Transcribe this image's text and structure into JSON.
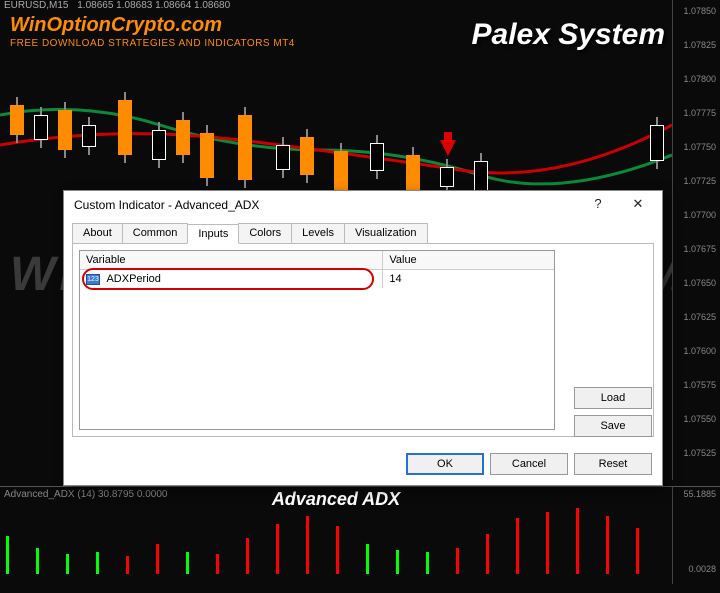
{
  "header": {
    "symbol": "EURUSD,M15",
    "ohlc": "1.08665 1.08683 1.08664 1.08680"
  },
  "branding": {
    "site": "WinOptionCrypto.com",
    "tagline": "FREE DOWNLOAD STRATEGIES AND INDICATORS MT4",
    "system": "Palex System",
    "watermark": "WINOPTIONCRYPTO.COM"
  },
  "price_axis": [
    "1.07850",
    "1.07825",
    "1.07800",
    "1.07775",
    "1.07750",
    "1.07725",
    "1.07700",
    "1.07675",
    "1.07650",
    "1.07625",
    "1.07600",
    "1.07575",
    "1.07550",
    "1.07525"
  ],
  "subwindow": {
    "label": "Advanced_ADX (14) 30.8795 0.0000",
    "title": "Advanced ADX",
    "ticks": [
      "55.1885",
      "0.0028"
    ]
  },
  "dialog": {
    "title": "Custom Indicator - Advanced_ADX",
    "help": "?",
    "close": "✕",
    "tabs": [
      "About",
      "Common",
      "Inputs",
      "Colors",
      "Levels",
      "Visualization"
    ],
    "activeTab": 2,
    "columns": {
      "variable": "Variable",
      "value": "Value"
    },
    "row": {
      "name": "ADXPeriod",
      "value": "14",
      "icon": "123"
    },
    "buttons": {
      "load": "Load",
      "save": "Save",
      "ok": "OK",
      "cancel": "Cancel",
      "reset": "Reset"
    }
  }
}
